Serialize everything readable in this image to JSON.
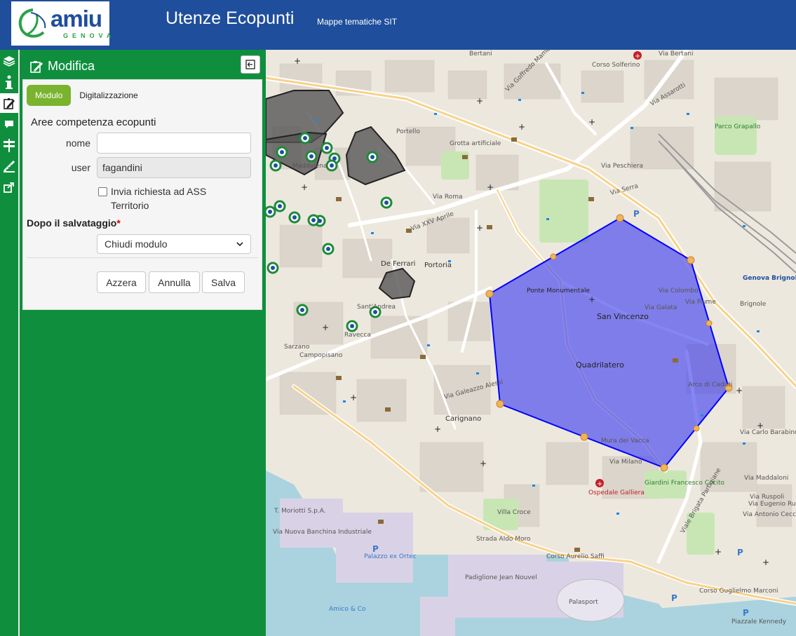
{
  "header": {
    "logo_text": "amiu",
    "logo_sub": "GENOVA",
    "title": "Utenze Ecopunti",
    "subtitle": "Mappe tematiche SIT"
  },
  "toolbar": {
    "items": [
      "layers-icon",
      "info-icon",
      "edit-icon",
      "comment-icon",
      "signpost-icon",
      "measure-icon",
      "share-icon"
    ]
  },
  "panel": {
    "title": "Modifica",
    "tabs": [
      {
        "label": "Modulo",
        "active": true
      },
      {
        "label": "Digitalizzazione",
        "active": false
      }
    ],
    "form_title": "Aree competenza ecopunti",
    "fields": {
      "nome": {
        "label": "nome",
        "value": ""
      },
      "user": {
        "label": "user",
        "value": "fagandini"
      }
    },
    "checkbox_label": "Invia richiesta ad ASS Territorio",
    "after_save_label": "Dopo il salvataggio",
    "required_mark": "*",
    "after_save_value": "Chiudi modulo",
    "buttons": {
      "reset": "Azzera",
      "cancel": "Annulla",
      "save": "Salva"
    }
  },
  "map": {
    "labels": [
      "Bertani",
      "Corso Solferino",
      "Via Goffredo Mameli",
      "Via Assarotti",
      "Parco Grapallo",
      "Portello",
      "Grotta artificiale",
      "Maddalena",
      "Via Peschiera",
      "Via Serra",
      "Via Roma",
      "Via XXV Aprile",
      "De Ferrari",
      "Portoria",
      "Ponte Monumentale",
      "San Vincenzo",
      "Quadrilatero",
      "Via Colombo",
      "Via Fiume",
      "Genova Brignole",
      "Brignole",
      "Via Galeazzo Alessi",
      "Carignano",
      "Ospedale Galliera",
      "Campopisano",
      "Sarzano",
      "Ravecca",
      "Sant'Andrea",
      "Arco di Caduti",
      "Via Maddaloni",
      "Via Antonio Cecchi",
      "Via Eugenio Ruspoli",
      "Corso Aurelio Saffi",
      "Strada Aldo Moro",
      "Palazzo ex Ortec",
      "Padiglione Jean Nouvel",
      "Palasport",
      "Corso Guglielmo Marconi",
      "Piazzale Kennedy",
      "T. Moriotti S.p.A.",
      "Via Nuova Banchina Industriale",
      "Amico & Co",
      "Villa Croce",
      "Via Carlo Barabino",
      "Viale Brigata Partigiane",
      "Via Galata",
      "Via Ruspoli",
      "Via Milano",
      "Giardini Francesco Cocito",
      "Mura dei Vacca",
      "Via Bertani"
    ],
    "accent": "#0000ff",
    "polygon_fill": "#4444ee"
  },
  "colors": {
    "header": "#1f4e9c",
    "panel": "#0f8f3e",
    "tab_active": "#7ab32e"
  }
}
